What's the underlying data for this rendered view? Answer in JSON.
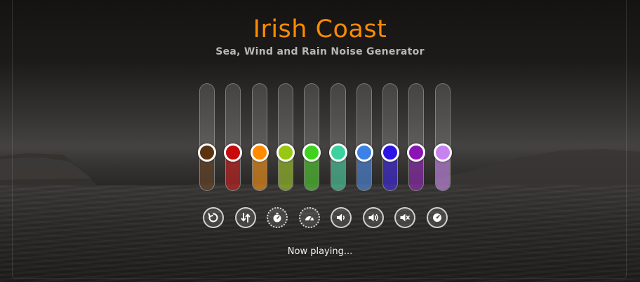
{
  "header": {
    "title": "Irish Coast",
    "subtitle": "Sea, Wind and Rain Noise Generator"
  },
  "sliders": [
    {
      "color": "#5a3310",
      "level": 0.36
    },
    {
      "color": "#c80a0a",
      "level": 0.36
    },
    {
      "color": "#ff8c00",
      "level": 0.36
    },
    {
      "color": "#99c814",
      "level": 0.36
    },
    {
      "color": "#3fd21e",
      "level": 0.36
    },
    {
      "color": "#3cd2a0",
      "level": 0.36
    },
    {
      "color": "#3c82e6",
      "level": 0.36
    },
    {
      "color": "#2d14e6",
      "level": 0.36
    },
    {
      "color": "#8c14b4",
      "level": 0.36
    },
    {
      "color": "#c882f0",
      "level": 0.36
    }
  ],
  "controls": [
    {
      "icon": "reset-icon"
    },
    {
      "icon": "shuffle-sliders-icon"
    },
    {
      "icon": "timer-icon"
    },
    {
      "icon": "animate-icon"
    },
    {
      "icon": "volume-down-icon"
    },
    {
      "icon": "volume-up-icon"
    },
    {
      "icon": "mute-icon"
    },
    {
      "icon": "settings-icon"
    }
  ],
  "status": {
    "text": "Now playing..."
  }
}
